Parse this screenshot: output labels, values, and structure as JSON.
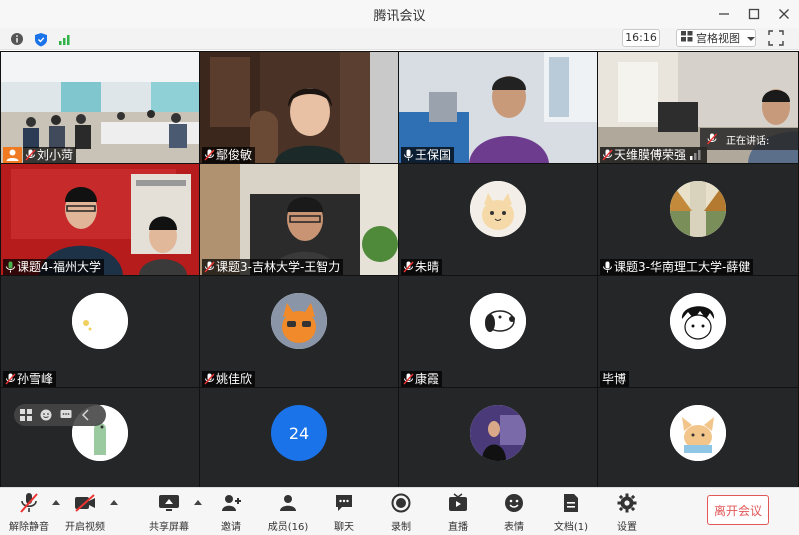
{
  "window": {
    "title": "腾讯会议"
  },
  "topbar": {
    "time": "16:16",
    "view_label": "宫格视图"
  },
  "speaking_label": "正在讲话:",
  "participants": [
    {
      "name": "刘小菏"
    },
    {
      "name": "鄢俊敏"
    },
    {
      "name": "王保国"
    },
    {
      "name": "天维膜傅荣强"
    },
    {
      "name": "课题4-福州大学"
    },
    {
      "name": "课题3-吉林大学-王智力"
    },
    {
      "name": "朱晴"
    },
    {
      "name": "课题3-华南理工大学-薛健"
    },
    {
      "name": "孙雪峰"
    },
    {
      "name": "姚佳欣"
    },
    {
      "name": "康霞"
    },
    {
      "name": "毕博"
    },
    {
      "name": ""
    },
    {
      "name": "",
      "avatar_text": "24"
    },
    {
      "name": ""
    },
    {
      "name": ""
    }
  ],
  "toolbar": {
    "mute": "解除静音",
    "video": "开启视频",
    "share": "共享屏幕",
    "invite": "邀请",
    "members": "成员(16)",
    "chat": "聊天",
    "record": "录制",
    "live": "直播",
    "reaction": "表情",
    "docs": "文档(1)",
    "settings": "设置",
    "leave": "离开会议"
  },
  "colors": {
    "accent_blue": "#1a73e8",
    "leave_red": "#e25757",
    "host_orange": "#f07a22",
    "tile_bg": "#242628"
  }
}
